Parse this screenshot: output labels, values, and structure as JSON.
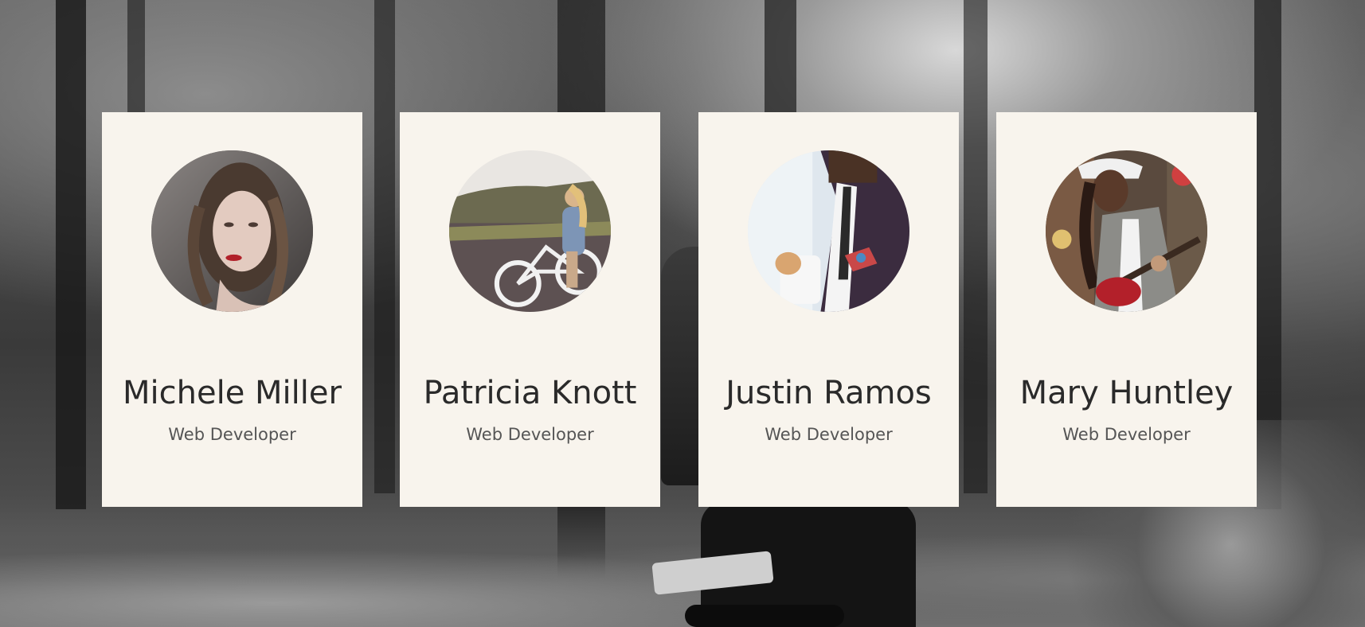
{
  "team": {
    "members": [
      {
        "name": "Michele Miller",
        "role": "Web Developer",
        "avatar_icon": "portrait-woman-photo"
      },
      {
        "name": "Patricia Knott",
        "role": "Web Developer",
        "avatar_icon": "woman-bicycle-photo"
      },
      {
        "name": "Justin Ramos",
        "role": "Web Developer",
        "avatar_icon": "man-suit-coffee-photo"
      },
      {
        "name": "Mary Huntley",
        "role": "Web Developer",
        "avatar_icon": "woman-guitar-photo"
      }
    ]
  },
  "colors": {
    "card_background": "#f8f4ed",
    "name_text": "#2a2a2a",
    "role_text": "#555555"
  }
}
